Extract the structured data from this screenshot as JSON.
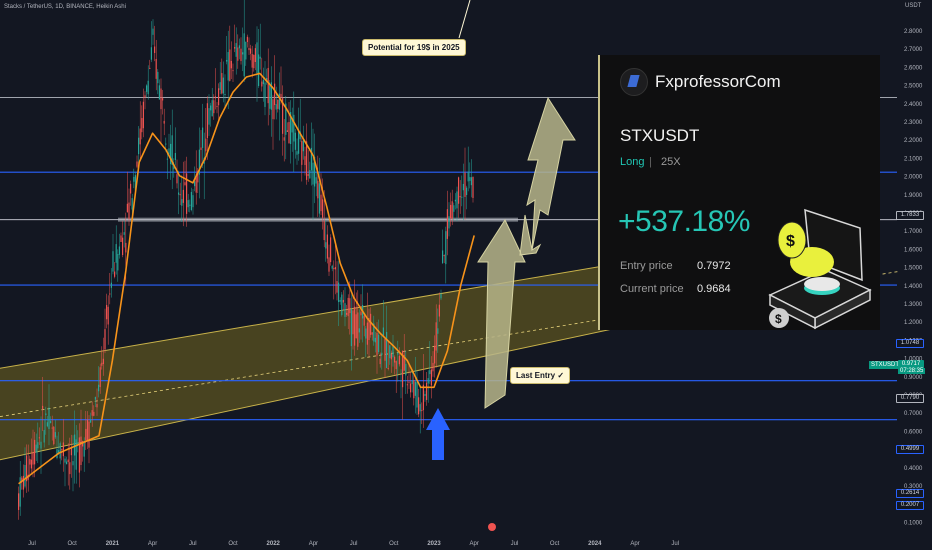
{
  "header": {
    "symbol_title": "Stacks / TetherUS, 1D, BINANCE, Heikin Ashi"
  },
  "axis": {
    "unit": "USDT",
    "log_scale": true,
    "grid": false
  },
  "price_tags": {
    "level_1": "1.7833",
    "level_2": "1.0748",
    "current": "0.9717",
    "countdown": "07:28:35",
    "level_3": "0.7790",
    "level_4": "0.4999",
    "level_5": "0.2614",
    "level_6": "0.2007"
  },
  "ticker_tag": "STXUSDT",
  "callouts": {
    "potential": "Potential for 19$ in 2025",
    "last_entry": "Last Entry ✓"
  },
  "card": {
    "brand": "FxprofessorCom",
    "pair": "STXUSDT",
    "side": "Long",
    "separator": "|",
    "leverage": "25X",
    "pnl": "+537.18%",
    "entry_label": "Entry price",
    "entry_value": "0.7972",
    "current_label": "Current price",
    "current_value": "0.9684"
  },
  "colors": {
    "background": "#131722",
    "up_candle": "#26a69a",
    "down_candle": "#ef5350",
    "moving_average": "#f7931a",
    "support_line": "#2962ff",
    "channel_fill": "#8a7a1e",
    "arrow_blue": "#2962ff",
    "arrow_grey": "#b7b58a"
  },
  "chart_data": {
    "type": "candlestick",
    "title": "Stacks / TetherUS, 1D, BINANCE, Heikin Ashi",
    "y_unit": "USDT",
    "y_scale": "log",
    "ylim": [
      0.1,
      2.9
    ],
    "y_ticks": [
      "2.8000",
      "2.7000",
      "2.6000",
      "2.5000",
      "2.4000",
      "2.3000",
      "2.2000",
      "2.1000",
      "2.0000",
      "1.9000",
      "1.8000",
      "1.7000",
      "1.6000",
      "1.5000",
      "1.4000",
      "1.3000",
      "1.2000",
      "1.1000",
      "1.0000",
      "0.9000",
      "0.8000",
      "0.7000",
      "0.6000",
      "0.5000",
      "0.4000",
      "0.3000",
      "0.2000",
      "0.1000"
    ],
    "x_ticks": [
      "Jul",
      "Oct",
      "2021",
      "Apr",
      "Jul",
      "Oct",
      "2022",
      "Apr",
      "Jul",
      "Oct",
      "2023",
      "Apr",
      "Jul",
      "Oct",
      "2024",
      "Apr",
      "Jul"
    ],
    "price_path": [
      {
        "date": "2020-06",
        "price": 0.12
      },
      {
        "date": "2020-07",
        "price": 0.16
      },
      {
        "date": "2020-08",
        "price": 0.2
      },
      {
        "date": "2020-09",
        "price": 0.17
      },
      {
        "date": "2020-10",
        "price": 0.15
      },
      {
        "date": "2020-11",
        "price": 0.18
      },
      {
        "date": "2020-12",
        "price": 0.24
      },
      {
        "date": "2021-01",
        "price": 0.55
      },
      {
        "date": "2021-02",
        "price": 0.75
      },
      {
        "date": "2021-03",
        "price": 1.3
      },
      {
        "date": "2021-04",
        "price": 2.5
      },
      {
        "date": "2021-05",
        "price": 1.5
      },
      {
        "date": "2021-06",
        "price": 0.95
      },
      {
        "date": "2021-07",
        "price": 0.9
      },
      {
        "date": "2021-08",
        "price": 1.5
      },
      {
        "date": "2021-09",
        "price": 1.9
      },
      {
        "date": "2021-10",
        "price": 2.3
      },
      {
        "date": "2021-11",
        "price": 2.5
      },
      {
        "date": "2021-12",
        "price": 2.2
      },
      {
        "date": "2022-01",
        "price": 1.8
      },
      {
        "date": "2022-02",
        "price": 1.5
      },
      {
        "date": "2022-03",
        "price": 1.25
      },
      {
        "date": "2022-04",
        "price": 1.15
      },
      {
        "date": "2022-05",
        "price": 0.7
      },
      {
        "date": "2022-06",
        "price": 0.45
      },
      {
        "date": "2022-07",
        "price": 0.38
      },
      {
        "date": "2022-08",
        "price": 0.4
      },
      {
        "date": "2022-09",
        "price": 0.33
      },
      {
        "date": "2022-10",
        "price": 0.31
      },
      {
        "date": "2022-11",
        "price": 0.28
      },
      {
        "date": "2022-12",
        "price": 0.22
      },
      {
        "date": "2023-01",
        "price": 0.3
      },
      {
        "date": "2023-02",
        "price": 0.75
      },
      {
        "date": "2023-03",
        "price": 1.0
      },
      {
        "date": "2023-04",
        "price": 0.97
      }
    ],
    "moving_average": [
      {
        "date": "2020-06",
        "price": 0.13
      },
      {
        "date": "2020-09",
        "price": 0.16
      },
      {
        "date": "2020-12",
        "price": 0.18
      },
      {
        "date": "2021-01",
        "price": 0.3
      },
      {
        "date": "2021-02",
        "price": 0.55
      },
      {
        "date": "2021-03",
        "price": 1.15
      },
      {
        "date": "2021-04",
        "price": 1.4
      },
      {
        "date": "2021-05",
        "price": 1.25
      },
      {
        "date": "2021-06",
        "price": 1.05
      },
      {
        "date": "2021-07",
        "price": 1.0
      },
      {
        "date": "2021-08",
        "price": 1.2
      },
      {
        "date": "2021-09",
        "price": 1.55
      },
      {
        "date": "2021-10",
        "price": 1.85
      },
      {
        "date": "2021-11",
        "price": 2.05
      },
      {
        "date": "2021-12",
        "price": 2.1
      },
      {
        "date": "2022-01",
        "price": 1.9
      },
      {
        "date": "2022-02",
        "price": 1.65
      },
      {
        "date": "2022-03",
        "price": 1.4
      },
      {
        "date": "2022-04",
        "price": 1.2
      },
      {
        "date": "2022-05",
        "price": 0.85
      },
      {
        "date": "2022-06",
        "price": 0.58
      },
      {
        "date": "2022-07",
        "price": 0.46
      },
      {
        "date": "2022-08",
        "price": 0.4
      },
      {
        "date": "2022-09",
        "price": 0.36
      },
      {
        "date": "2022-10",
        "price": 0.33
      },
      {
        "date": "2022-11",
        "price": 0.3
      },
      {
        "date": "2022-12",
        "price": 0.25
      },
      {
        "date": "2023-01",
        "price": 0.25
      },
      {
        "date": "2023-02",
        "price": 0.32
      },
      {
        "date": "2023-03",
        "price": 0.5
      },
      {
        "date": "2023-04",
        "price": 0.7
      }
    ],
    "horizontal_levels": [
      {
        "price": 1.7833,
        "style": "white"
      },
      {
        "price": 1.0748,
        "style": "blue"
      },
      {
        "price": 0.779,
        "style": "white"
      },
      {
        "price": 0.4999,
        "style": "blue"
      },
      {
        "price": 0.2614,
        "style": "blue"
      },
      {
        "price": 0.2007,
        "style": "blue"
      }
    ],
    "current_price": 0.9717,
    "channel": {
      "upper": [
        {
          "date": "2020-06",
          "price": 0.28
        },
        {
          "date": "2024-10",
          "price": 0.67
        }
      ],
      "lower": [
        {
          "date": "2020-06",
          "price": 0.15
        },
        {
          "date": "2024-10",
          "price": 0.45
        }
      ]
    },
    "annotations": [
      "Potential for 19$ in 2025",
      "Last Entry ✓"
    ]
  }
}
